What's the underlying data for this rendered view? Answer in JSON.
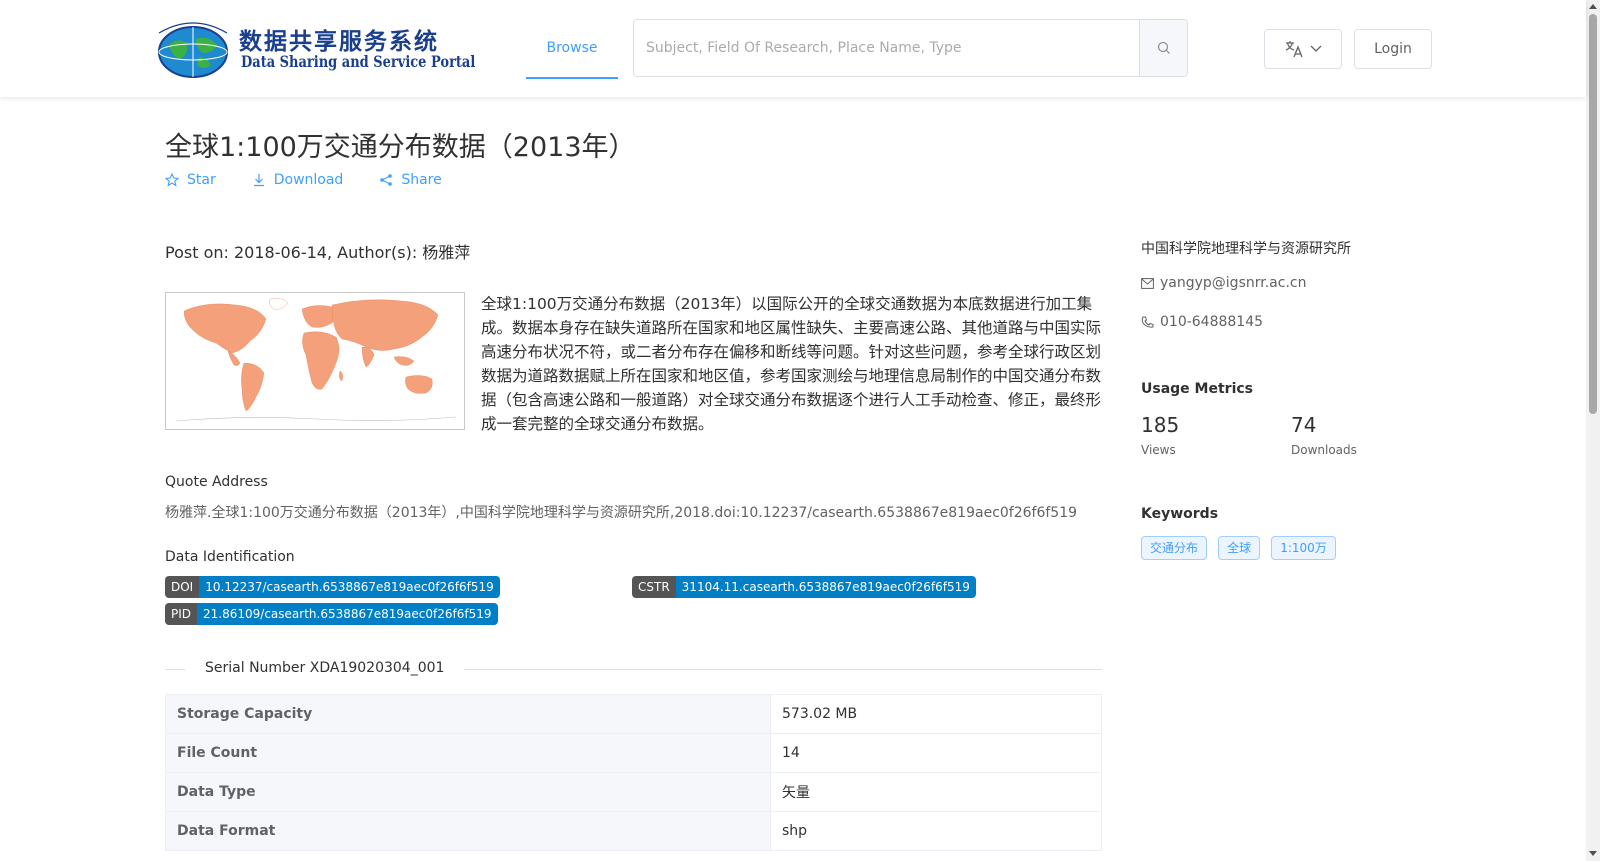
{
  "header": {
    "logo_cn": "数据共享服务系统",
    "logo_en": "Data Sharing and Service Portal",
    "nav_browse": "Browse",
    "search_placeholder": "Subject, Field Of Research, Place Name, Type",
    "login": "Login"
  },
  "dataset": {
    "title": "全球1:100万交通分布数据（2013年）",
    "actions": {
      "star": "Star",
      "download": "Download",
      "share": "Share"
    },
    "post_info": "Post on: 2018-06-14, Author(s): 杨雅萍",
    "description": "全球1:100万交通分布数据（2013年）以国际公开的全球交通数据为本底数据进行加工集成。数据本身存在缺失道路所在国家和地区属性缺失、主要高速公路、其他道路与中国实际高速分布状况不符，或二者分布存在偏移和断线等问题。针对这些问题，参考全球行政区划数据为道路数据赋上所在国家和地区值，参考国家测绘与地理信息局制作的中国交通分布数据（包含高速公路和一般道路）对全球交通分布数据逐个进行人工手动检查、修正，最终形成一套完整的全球交通分布数据。",
    "quote_label": "Quote Address",
    "quote_text": "杨雅萍.全球1:100万交通分布数据（2013年）,中国科学院地理科学与资源研究所,2018.doi:10.12237/casearth.6538867e819aec0f26f6f519",
    "identification_label": "Data Identification",
    "ids": {
      "doi_key": "DOI",
      "doi_val": "10.12237/casearth.6538867e819aec0f26f6f519",
      "cstr_key": "CSTR",
      "cstr_val": "31104.11.casearth.6538867e819aec0f26f6f519",
      "pid_key": "PID",
      "pid_val": "21.86109/casearth.6538867e819aec0f26f6f519"
    },
    "serial": "Serial Number XDA19020304_001",
    "info_rows": [
      {
        "label": "Storage Capacity",
        "value": "573.02 MB"
      },
      {
        "label": "File Count",
        "value": "14"
      },
      {
        "label": "Data Type",
        "value": "矢量"
      },
      {
        "label": "Data Format",
        "value": "shp"
      }
    ]
  },
  "sidebar": {
    "organization": "中国科学院地理科学与资源研究所",
    "email": "yangyp@igsnrr.ac.cn",
    "phone": "010-64888145",
    "usage_title": "Usage Metrics",
    "views_num": "185",
    "views_label": "Views",
    "downloads_num": "74",
    "downloads_label": "Downloads",
    "keywords_title": "Keywords",
    "keywords": [
      "交通分布",
      "全球",
      "1:100万"
    ]
  },
  "colors": {
    "accent": "#409eff",
    "badge_key": "#555555",
    "badge_value": "#007ec6",
    "map_fill": "#f4a07a"
  }
}
